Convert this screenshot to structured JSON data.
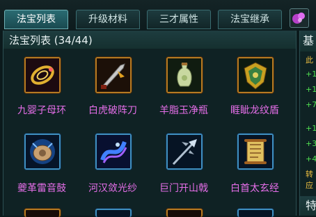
{
  "tabs": [
    {
      "label": "法宝列表",
      "active": true
    },
    {
      "label": "升级材料",
      "active": false
    },
    {
      "label": "三才属性",
      "active": false
    },
    {
      "label": "法宝继承",
      "active": false
    }
  ],
  "panel": {
    "title": "法宝列表 (34/44)"
  },
  "items": [
    {
      "name": "九婴子母环",
      "color": "#e56ee8",
      "icon": "ring-icon"
    },
    {
      "name": "白虎破阵刀",
      "color": "#e56ee8",
      "icon": "blade-icon"
    },
    {
      "name": "羊脂玉净瓶",
      "color": "#e56ee8",
      "icon": "vase-icon"
    },
    {
      "name": "睚眦龙纹盾",
      "color": "#e56ee8",
      "icon": "shield-icon"
    },
    {
      "name": "夔革雷音鼓",
      "color": "#e56ee8",
      "icon": "drum-icon"
    },
    {
      "name": "河汉敛光纱",
      "color": "#e56ee8",
      "icon": "veil-icon"
    },
    {
      "name": "巨门开山戟",
      "color": "#e56ee8",
      "icon": "halberd-icon"
    },
    {
      "name": "白首太玄经",
      "color": "#e56ee8",
      "icon": "scroll-icon"
    }
  ],
  "right_panel": {
    "header": "基",
    "lines": [
      {
        "text": "此",
        "color": "#f0c040"
      },
      {
        "text": "+1",
        "color": "#50e050"
      },
      {
        "text": "+1",
        "color": "#50e050"
      },
      {
        "text": "+7",
        "color": "#50e050"
      },
      {
        "text": "+1",
        "color": "#50e050"
      },
      {
        "text": "+3",
        "color": "#50e050"
      },
      {
        "text": "+4",
        "color": "#50e050"
      },
      {
        "text": "转",
        "color": "#f0c040"
      },
      {
        "text": "应",
        "color": "#f0c040"
      }
    ],
    "footer": "特"
  }
}
